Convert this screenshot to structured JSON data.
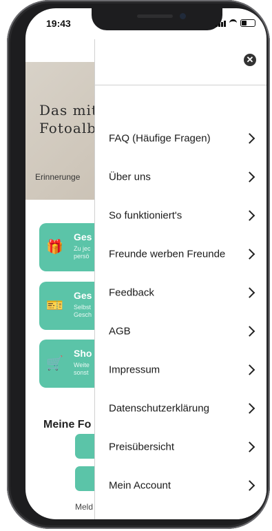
{
  "status_bar": {
    "time": "19:43"
  },
  "app": {
    "hero": {
      "title": "Das mit\nFotoalb",
      "subtitle": "Erinnerunge"
    },
    "cards": [
      {
        "title": "Ges",
        "desc": "Zu jec\npersö",
        "icon": "gift-icon"
      },
      {
        "title": "Ges",
        "desc": "Selbst\nGesch",
        "icon": "voucher-icon"
      },
      {
        "title": "Sho",
        "desc": "Weite\nsonst",
        "icon": "cart-icon"
      }
    ],
    "section_title": "Meine Fo",
    "footer_text": "Meld"
  },
  "menu": {
    "close_icon": "close-icon",
    "items": [
      {
        "label": "FAQ (Häufige Fragen)"
      },
      {
        "label": "Über uns"
      },
      {
        "label": "So funktioniert's"
      },
      {
        "label": "Freunde werben Freunde"
      },
      {
        "label": "Feedback"
      },
      {
        "label": "AGB"
      },
      {
        "label": "Impressum"
      },
      {
        "label": "Datenschutzerklärung"
      },
      {
        "label": "Preisübersicht"
      },
      {
        "label": "Mein Account"
      }
    ]
  },
  "colors": {
    "accent": "#5bc4a8",
    "frame": "#1d1d1f"
  }
}
